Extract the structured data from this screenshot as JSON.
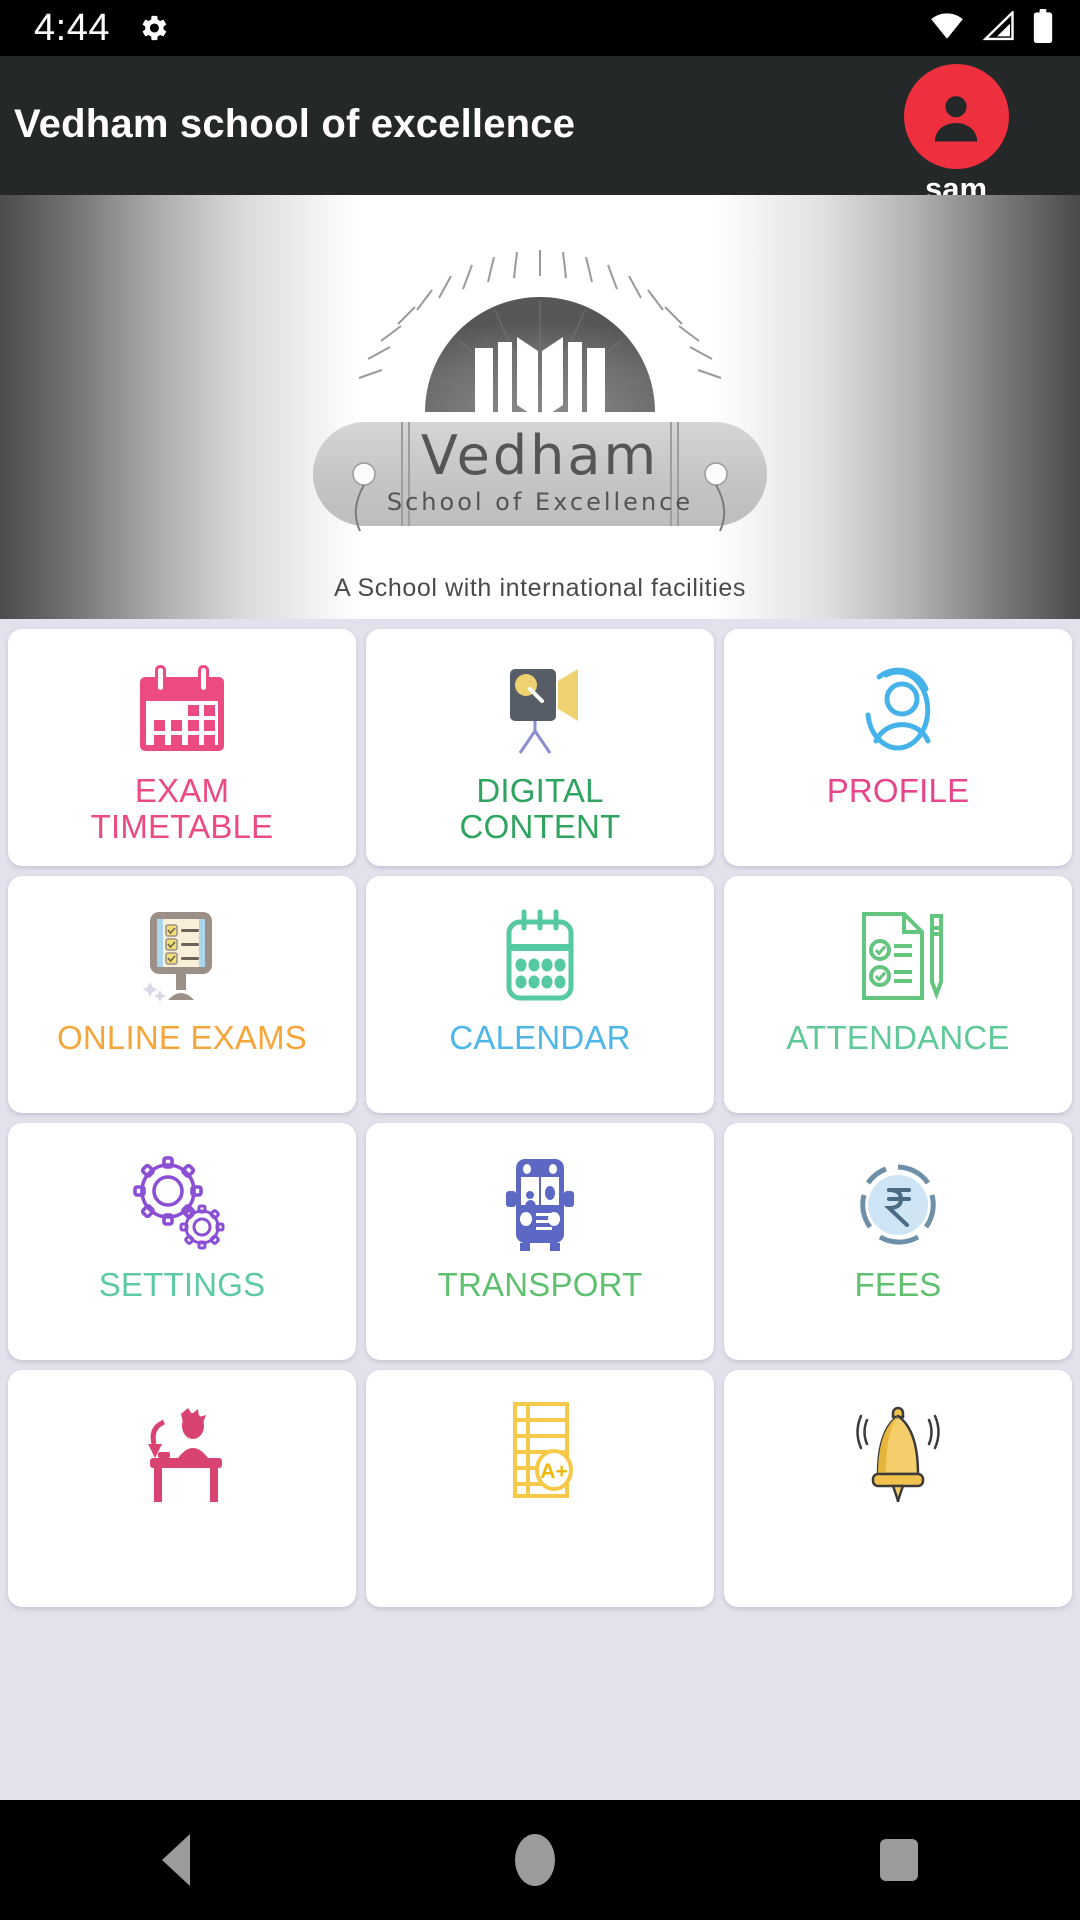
{
  "status_bar": {
    "time": "4:44",
    "icons": [
      "gear-icon",
      "wifi-icon",
      "cellular-signal-icon",
      "battery-icon"
    ]
  },
  "app_bar": {
    "title": "Vedham school of excellence",
    "user_name": "sam",
    "avatar_color": "#EE2F3E",
    "background_color": "#252829"
  },
  "banner": {
    "logo_name": "Vedham",
    "logo_subtitle": "School of Excellence",
    "tagline": "A School with international facilities"
  },
  "grid": {
    "tiles": [
      {
        "label": "EXAM\nTIMETABLE",
        "icon": "calendar-exam-icon",
        "color": "#EC4B81"
      },
      {
        "label": "DIGITAL\nCONTENT",
        "icon": "video-projector-icon",
        "color": "#2FA45F"
      },
      {
        "label": "PROFILE",
        "icon": "user-circle-icon",
        "color": "#E8468A"
      },
      {
        "label": "ONLINE EXAMS",
        "icon": "monitor-checklist-icon",
        "color": "#F5A63A"
      },
      {
        "label": "CALENDAR",
        "icon": "calendar-icon",
        "color": "#4FB6E8"
      },
      {
        "label": "ATTENDANCE",
        "icon": "checklist-pencil-icon",
        "color": "#5FC999"
      },
      {
        "label": "SETTINGS",
        "icon": "gears-icon",
        "color": "#5FC9A3"
      },
      {
        "label": "TRANSPORT",
        "icon": "school-bus-icon",
        "color": "#5FC06F"
      },
      {
        "label": "FEES",
        "icon": "rupee-coin-icon",
        "color": "#5FC06F"
      },
      {
        "label": "",
        "icon": "homework-desk-icon",
        "color": "#D94372"
      },
      {
        "label": "",
        "icon": "report-card-icon",
        "color": "#F7C948"
      },
      {
        "label": "",
        "icon": "notification-bell-icon",
        "color": "#F2C14E"
      }
    ]
  },
  "nav_bar": {
    "back_label": "Back",
    "home_label": "Home",
    "recents_label": "Recents"
  }
}
